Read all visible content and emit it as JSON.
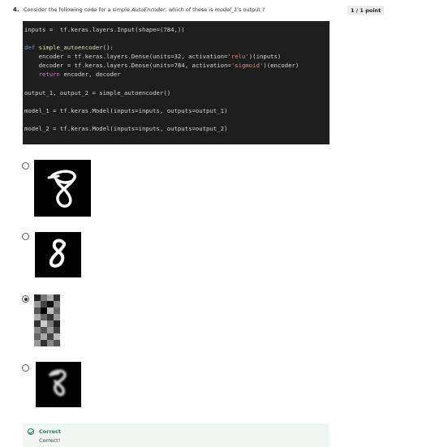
{
  "question": {
    "number": "4.",
    "text_before": "Consider the following code for a simple ",
    "text_em1": "AutoEncoder",
    "text_middle": ", which of these is ",
    "text_em2": "model_1",
    "text_after": "'s output ?",
    "points": "1 / 1 point"
  },
  "code": {
    "line1": "inputs =  tf.keras.layers.Input(shape=(784,))",
    "line2_kw": "def",
    "line2_fn": "simple_autoencoder",
    "line2_rest": "():",
    "line3_a": "    encoder = tf.keras.layers.Dense(units=32, activation=",
    "line3_str": "'relu'",
    "line3_b": ")(inputs)",
    "line4_a": "    decoder = tf.keras.layers.Dense(units=784, activation=",
    "line4_str": "'sigmoid'",
    "line4_b": ")(encoder)",
    "line5_kw": "return",
    "line5_rest": " encoder, decoder",
    "line6": "output_1, output_2 = simple_autoencoder()",
    "line7": "model_1 = tf.keras.Model(inputs=inputs, outputs=output_1)",
    "line8": "model_2 = tf.keras.Model(inputs=inputs, outputs=output_2)"
  },
  "options": [
    {
      "selected": false,
      "image": "digit-8-original-image"
    },
    {
      "selected": false,
      "image": "digit-8-clean-image"
    },
    {
      "selected": true,
      "image": "encoded-grid-image"
    },
    {
      "selected": false,
      "image": "digit-reconstructed-image"
    }
  ],
  "feedback": {
    "title": "Correct",
    "text": "Correct!"
  }
}
